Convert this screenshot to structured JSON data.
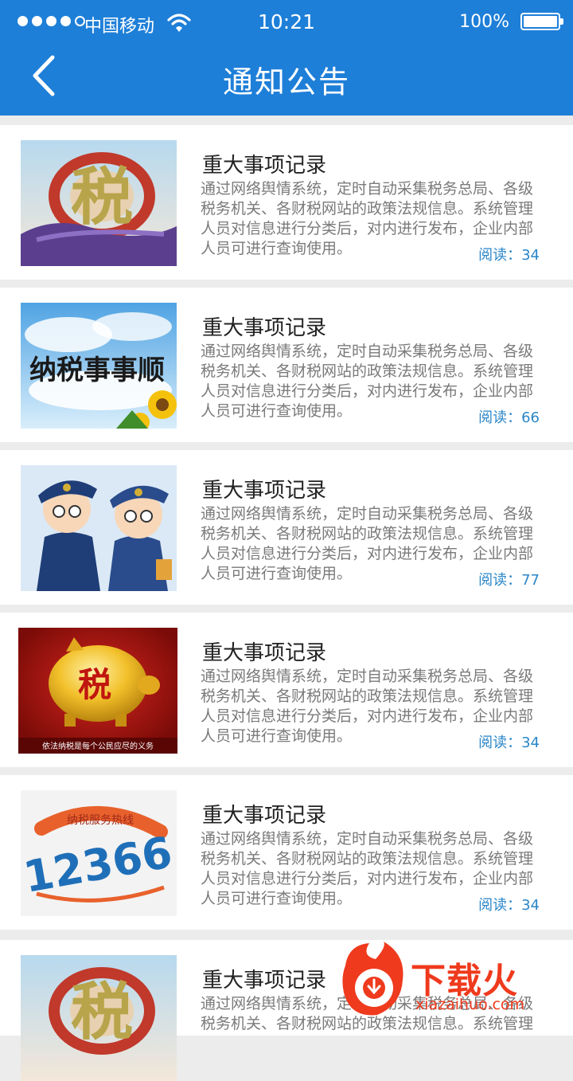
{
  "status_bar": {
    "carrier": "中国移动",
    "time": "10:21",
    "battery": "100%"
  },
  "header": {
    "title": "通知公告"
  },
  "reads_prefix": "阅读：",
  "notices": [
    {
      "title": "重大事项记录",
      "desc": "通过网络舆情系统，定时自动采集税务总局、各级税务机关、各财税网站的政策法规信息。系统管理人员对信息进行分类后，对内进行发布，企业内部人员可进行查询使用。",
      "reads": "阅读：34",
      "image": "tax-emblem-hand",
      "image_text": "税"
    },
    {
      "title": "重大事项记录",
      "desc": "通过网络舆情系统，定时自动采集税务总局、各级税务机关、各财税网站的政策法规信息。系统管理人员对信息进行分类后，对内进行发布，企业内部人员可进行查询使用。",
      "reads": "阅读：66",
      "image": "sky-sunflower-banner",
      "image_text": "纳税事事顺"
    },
    {
      "title": "重大事项记录",
      "desc": "通过网络舆情系统，定时自动采集税务总局、各级税务机关、各财税网站的政策法规信息。系统管理人员对信息进行分类后，对内进行发布，企业内部人员可进行查询使用。",
      "reads": "阅读：77",
      "image": "tax-officer-cartoon"
    },
    {
      "title": "重大事项记录",
      "desc": "通过网络舆情系统，定时自动采集税务总局、各级税务机关、各财税网站的政策法规信息。系统管理人员对信息进行分类后，对内进行发布，企业内部人员可进行查询使用。",
      "reads": "阅读：34",
      "image": "golden-piggy-bank",
      "image_text": "税",
      "image_caption": "依法纳税是每个公民应尽的义务"
    },
    {
      "title": "重大事项记录",
      "desc": "通过网络舆情系统，定时自动采集税务总局、各级税务机关、各财税网站的政策法规信息。系统管理人员对信息进行分类后，对内进行发布，企业内部人员可进行查询使用。",
      "reads": "阅读：34",
      "image": "tax-hotline-12366",
      "image_text": "12366",
      "image_caption": "纳税服务热线"
    },
    {
      "title": "重大事项记录",
      "desc": "通过网络舆情系统，定时自动采集税务总局、各级税务机关、各财税网站的政策法规信息。系统管理人员对信息进行分类后，对内进行发布，企业内部人员可进行查询使用。",
      "reads": "",
      "image": "tax-emblem-hand",
      "image_text": "税"
    }
  ],
  "watermark": {
    "name": "下载火",
    "url": "xiazaihuo.com"
  },
  "colors": {
    "header": "#1e7fd8",
    "reads": "#2a86c8",
    "watermark": "#ef3a1d"
  }
}
